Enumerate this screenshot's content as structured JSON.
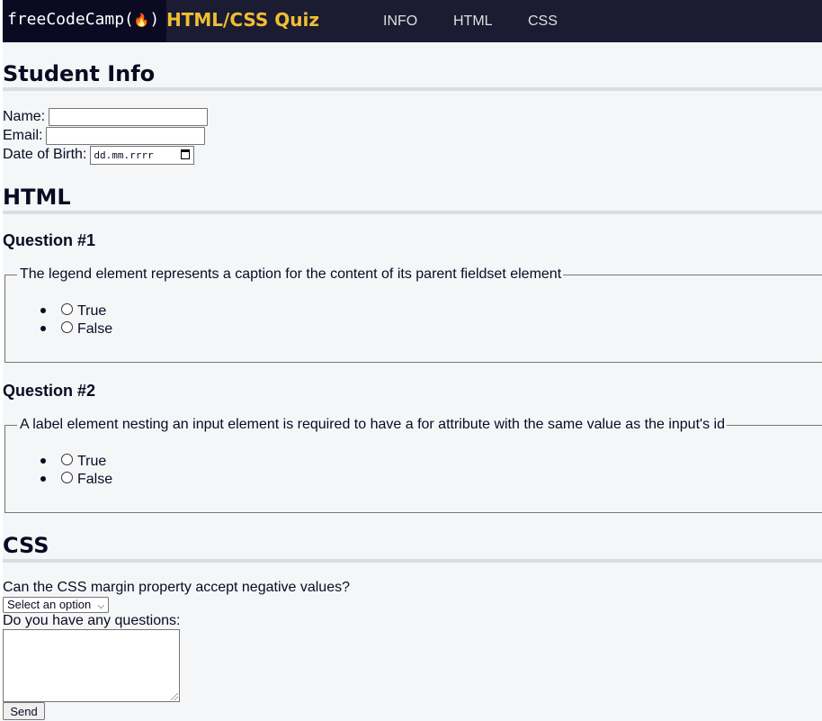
{
  "header": {
    "logo_text": "freeCodeCamp(",
    "logo_flame": "🔥",
    "logo_close": ")",
    "title": "HTML/CSS Quiz",
    "nav": [
      "INFO",
      "HTML",
      "CSS"
    ]
  },
  "student_info": {
    "heading": "Student Info",
    "name_label": "Name:",
    "email_label": "Email:",
    "dob_label": "Date of Birth:",
    "dob_placeholder": "dd.mm.rrrr"
  },
  "html_section": {
    "heading": "HTML",
    "questions": [
      {
        "title": "Question #1",
        "legend": "The legend element represents a caption for the content of its parent fieldset element",
        "options": [
          "True",
          "False"
        ]
      },
      {
        "title": "Question #2",
        "legend": "A label element nesting an input element is required to have a for attribute with the same value as the input's id",
        "options": [
          "True",
          "False"
        ]
      }
    ]
  },
  "css_section": {
    "heading": "CSS",
    "question": "Can the CSS margin property accept negative values?",
    "select_value": "Select an option",
    "textarea_label": "Do you have any questions:",
    "send_label": "Send"
  },
  "colors": {
    "header_bg": "#1b1b32",
    "logo_bg": "#0a0a23",
    "title_color": "#f1be32",
    "page_bg": "#f5f6f7"
  }
}
